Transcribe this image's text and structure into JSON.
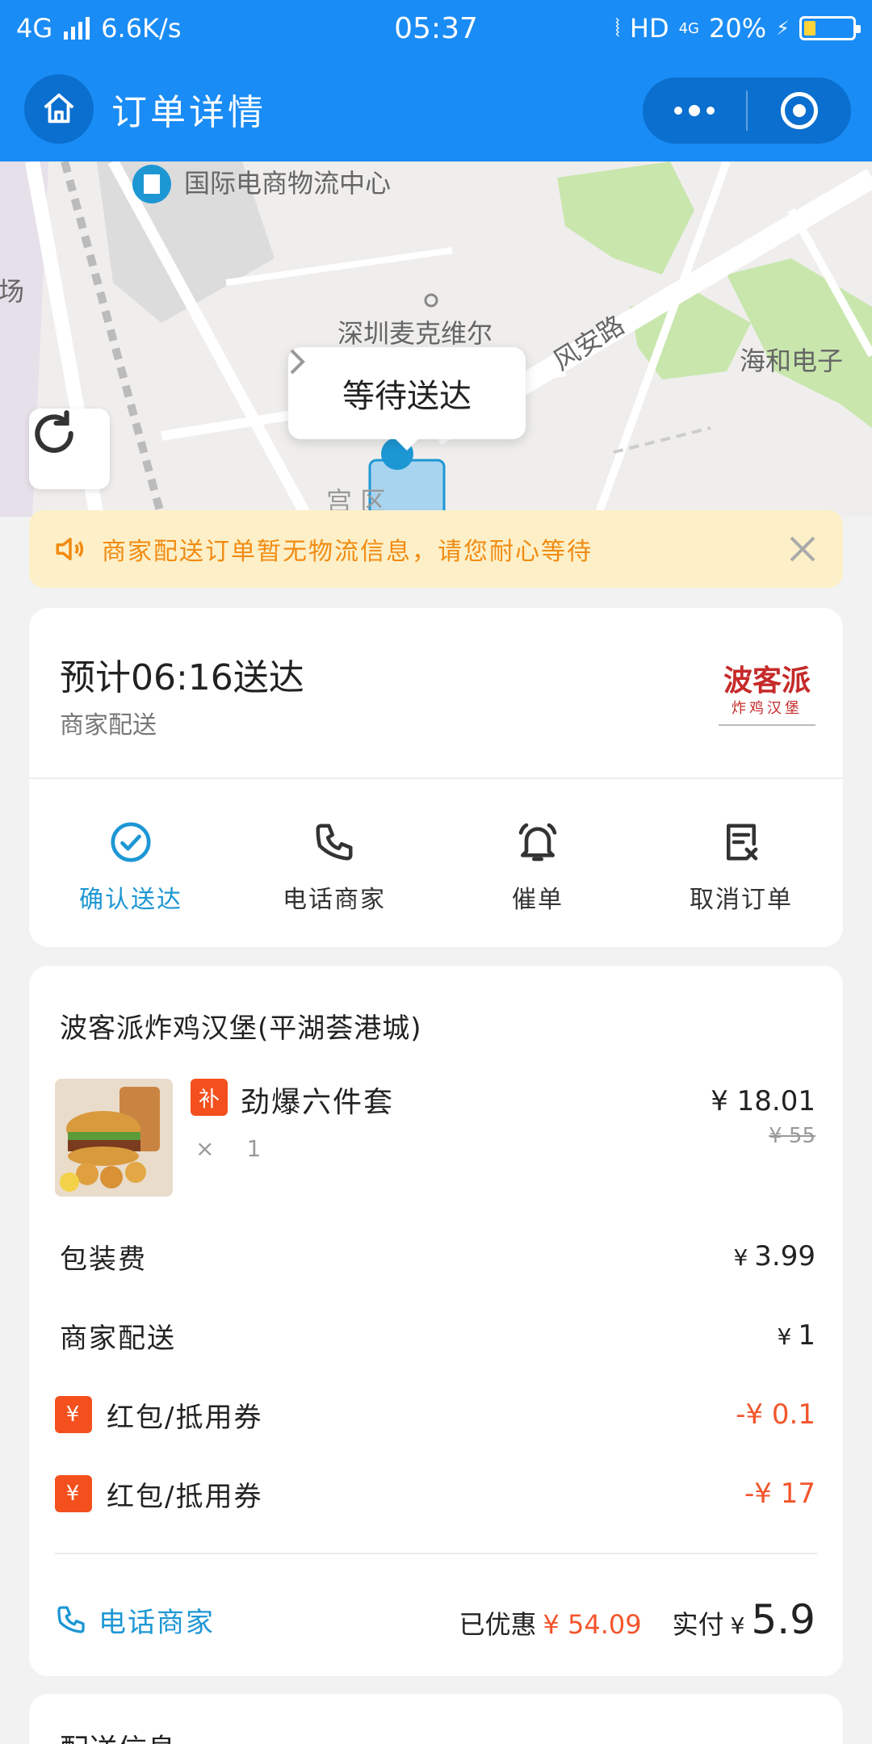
{
  "status_bar": {
    "network": "4G",
    "speed": "6.6K/s",
    "time": "05:37",
    "hd": "HD",
    "net_small": "4G",
    "battery": "20%"
  },
  "navbar": {
    "title": "订单详情"
  },
  "map": {
    "labels": {
      "logistics": "国际电商物流中心",
      "plaza": "场",
      "mike": "深圳麦克维尔",
      "road": "风安路",
      "haihe": "海和电子",
      "area": "宫 区"
    },
    "status": "等待送达"
  },
  "notice": {
    "text": "商家配送订单暂无物流信息，请您耐心等待"
  },
  "delivery": {
    "eta": "预计06:16送达",
    "method": "商家配送",
    "logo_line1": "波客派",
    "logo_line2": "炸鸡汉堡"
  },
  "actions": [
    {
      "label": "确认送达",
      "icon": "check-circle-icon"
    },
    {
      "label": "电话商家",
      "icon": "phone-icon"
    },
    {
      "label": "催单",
      "icon": "bell-icon"
    },
    {
      "label": "取消订单",
      "icon": "cancel-order-icon"
    }
  ],
  "order": {
    "shop_name": "波客派炸鸡汉堡(平湖荟港城)",
    "item": {
      "tag": "补",
      "name": "劲爆六件套",
      "qty_x": "×",
      "qty": "1",
      "price": "¥ 18.01",
      "original_price": "¥ 55"
    },
    "fees": [
      {
        "label": "包装费",
        "value": "3.99",
        "prefix": "¥"
      },
      {
        "label": "商家配送",
        "value": "1",
        "prefix": "¥"
      }
    ],
    "coupons": [
      {
        "badge": "¥",
        "label": "红包/抵用券",
        "value": "-¥ 0.1"
      },
      {
        "badge": "¥",
        "label": "红包/抵用券",
        "value": "-¥ 17"
      }
    ],
    "footer": {
      "call": "电话商家",
      "discount_label": "已优惠",
      "discount_value": "¥ 54.09",
      "paid_label": "实付",
      "paid_yen": "¥",
      "paid_value": "5.9"
    }
  },
  "next_section": {
    "title": "配送信息"
  },
  "colors": {
    "brand_blue": "#1a8cf5",
    "accent_blue": "#1d97d4",
    "red": "#f2552c",
    "notice_bg": "#fdf0c8",
    "notice_text": "#f18b12"
  }
}
